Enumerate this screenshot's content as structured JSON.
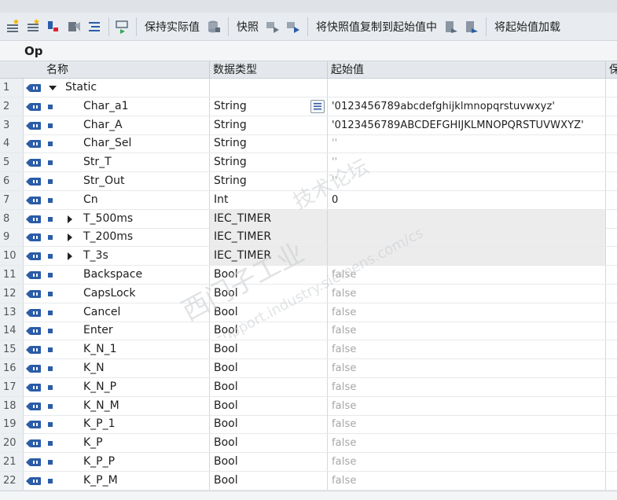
{
  "toolbar": {
    "buttons": [
      {
        "icon": "insert-row-icon"
      },
      {
        "icon": "add-row-icon"
      },
      {
        "icon": "expand-icon"
      },
      {
        "icon": "collapse-icon"
      },
      {
        "icon": "list-icon"
      },
      {
        "icon": "monitor-icon"
      }
    ],
    "keep_actual_label": "保持实际值",
    "snapshot_label": "快照",
    "copy_snapshot_label": "将快照值复制到起始值中",
    "load_start_label": "将起始值加载"
  },
  "block_title": "Op",
  "columns": {
    "name": "名称",
    "datatype": "数据类型",
    "start_value": "起始值",
    "retain": "保"
  },
  "rows": [
    {
      "num": "1",
      "name": "Static",
      "type": "",
      "value": "",
      "level": 0,
      "expander": "expanded",
      "marker": false,
      "value_gray": false,
      "edit": false,
      "shaded": false
    },
    {
      "num": "2",
      "name": "Char_a1",
      "type": "String",
      "value": "'0123456789abcdefghijklmnopqrstuvwxyz'",
      "level": 1,
      "expander": "",
      "marker": true,
      "value_gray": false,
      "edit": true,
      "shaded": false
    },
    {
      "num": "3",
      "name": "Char_A",
      "type": "String",
      "value": "'0123456789ABCDEFGHIJKLMNOPQRSTUVWXYZ'",
      "level": 1,
      "expander": "",
      "marker": true,
      "value_gray": false,
      "edit": false,
      "shaded": false
    },
    {
      "num": "4",
      "name": "Char_Sel",
      "type": "String",
      "value": "''",
      "level": 1,
      "expander": "",
      "marker": true,
      "value_gray": true,
      "edit": false,
      "shaded": false
    },
    {
      "num": "5",
      "name": "Str_T",
      "type": "String",
      "value": "''",
      "level": 1,
      "expander": "",
      "marker": true,
      "value_gray": true,
      "edit": false,
      "shaded": false
    },
    {
      "num": "6",
      "name": "Str_Out",
      "type": "String",
      "value": "''",
      "level": 1,
      "expander": "",
      "marker": true,
      "value_gray": true,
      "edit": false,
      "shaded": false
    },
    {
      "num": "7",
      "name": "Cn",
      "type": "Int",
      "value": "0",
      "level": 1,
      "expander": "",
      "marker": true,
      "value_gray": false,
      "edit": false,
      "shaded": false
    },
    {
      "num": "8",
      "name": "T_500ms",
      "type": "IEC_TIMER",
      "value": "",
      "level": 1,
      "expander": "collapsed",
      "marker": true,
      "value_gray": false,
      "edit": false,
      "shaded": true
    },
    {
      "num": "9",
      "name": "T_200ms",
      "type": "IEC_TIMER",
      "value": "",
      "level": 1,
      "expander": "collapsed",
      "marker": true,
      "value_gray": false,
      "edit": false,
      "shaded": true
    },
    {
      "num": "10",
      "name": "T_3s",
      "type": "IEC_TIMER",
      "value": "",
      "level": 1,
      "expander": "collapsed",
      "marker": true,
      "value_gray": false,
      "edit": false,
      "shaded": true
    },
    {
      "num": "11",
      "name": "Backspace",
      "type": "Bool",
      "value": "false",
      "level": 1,
      "expander": "",
      "marker": true,
      "value_gray": true,
      "edit": false,
      "shaded": false
    },
    {
      "num": "12",
      "name": "CapsLock",
      "type": "Bool",
      "value": "false",
      "level": 1,
      "expander": "",
      "marker": true,
      "value_gray": true,
      "edit": false,
      "shaded": false
    },
    {
      "num": "13",
      "name": "Cancel",
      "type": "Bool",
      "value": "false",
      "level": 1,
      "expander": "",
      "marker": true,
      "value_gray": true,
      "edit": false,
      "shaded": false
    },
    {
      "num": "14",
      "name": "Enter",
      "type": "Bool",
      "value": "false",
      "level": 1,
      "expander": "",
      "marker": true,
      "value_gray": true,
      "edit": false,
      "shaded": false
    },
    {
      "num": "15",
      "name": "K_N_1",
      "type": "Bool",
      "value": "false",
      "level": 1,
      "expander": "",
      "marker": true,
      "value_gray": true,
      "edit": false,
      "shaded": false
    },
    {
      "num": "16",
      "name": "K_N",
      "type": "Bool",
      "value": "false",
      "level": 1,
      "expander": "",
      "marker": true,
      "value_gray": true,
      "edit": false,
      "shaded": false
    },
    {
      "num": "17",
      "name": "K_N_P",
      "type": "Bool",
      "value": "false",
      "level": 1,
      "expander": "",
      "marker": true,
      "value_gray": true,
      "edit": false,
      "shaded": false
    },
    {
      "num": "18",
      "name": "K_N_M",
      "type": "Bool",
      "value": "false",
      "level": 1,
      "expander": "",
      "marker": true,
      "value_gray": true,
      "edit": false,
      "shaded": false
    },
    {
      "num": "19",
      "name": "K_P_1",
      "type": "Bool",
      "value": "false",
      "level": 1,
      "expander": "",
      "marker": true,
      "value_gray": true,
      "edit": false,
      "shaded": false
    },
    {
      "num": "20",
      "name": "K_P",
      "type": "Bool",
      "value": "false",
      "level": 1,
      "expander": "",
      "marker": true,
      "value_gray": true,
      "edit": false,
      "shaded": false
    },
    {
      "num": "21",
      "name": "K_P_P",
      "type": "Bool",
      "value": "false",
      "level": 1,
      "expander": "",
      "marker": true,
      "value_gray": true,
      "edit": false,
      "shaded": false
    },
    {
      "num": "22",
      "name": "K_P_M",
      "type": "Bool",
      "value": "false",
      "level": 1,
      "expander": "",
      "marker": true,
      "value_gray": true,
      "edit": false,
      "shaded": false
    }
  ],
  "watermark": {
    "line1": "西门子工业",
    "line2": "技术论坛",
    "line3": "support.industry.siemens.com/cs"
  },
  "colors": {
    "interface_icon": "#2a5ca8",
    "toolbar_bg": "#e8ecf0",
    "header_bg": "#e4e8ec",
    "gray_value": "#a6a6a6"
  }
}
